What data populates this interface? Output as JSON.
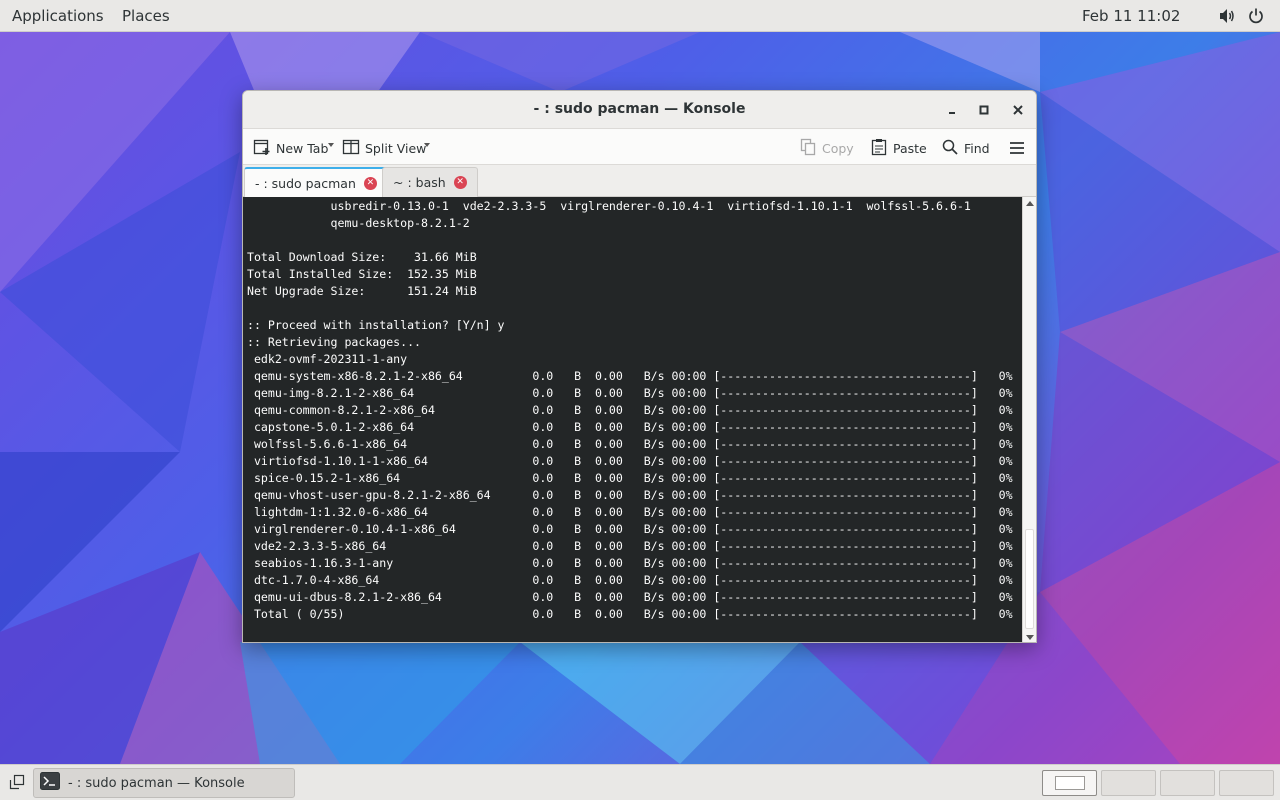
{
  "topbar": {
    "menu_applications": "Applications",
    "menu_places": "Places",
    "clock": "Feb 11  11:02",
    "volume_icon": "volume-icon",
    "power_icon": "power-icon"
  },
  "window": {
    "title": "- : sudo pacman — Konsole",
    "controls": [
      "minimize-icon",
      "maximize-icon",
      "close-icon"
    ]
  },
  "toolbar": {
    "new_tab": "New Tab",
    "split_view": "Split View",
    "copy": "Copy",
    "paste": "Paste",
    "find": "Find",
    "menu_icon": "hamburger-menu-icon"
  },
  "tabs": [
    {
      "label": "- : sudo pacman",
      "active": true
    },
    {
      "label": "~ : bash",
      "active": false
    }
  ],
  "terminal": {
    "lines": [
      "            usbredir-0.13.0-1  vde2-2.3.3-5  virglrenderer-0.10.4-1  virtiofsd-1.10.1-1  wolfssl-5.6.6-1",
      "            qemu-desktop-8.2.1-2",
      "",
      "Total Download Size:    31.66 MiB",
      "Total Installed Size:  152.35 MiB",
      "Net Upgrade Size:      151.24 MiB",
      "",
      ":: Proceed with installation? [Y/n] y",
      ":: Retrieving packages...",
      " edk2-ovmf-202311-1-any",
      " qemu-system-x86-8.2.1-2-x86_64          0.0   B  0.00   B/s 00:00 [------------------------------------]   0%",
      " qemu-img-8.2.1-2-x86_64                 0.0   B  0.00   B/s 00:00 [------------------------------------]   0%",
      " qemu-common-8.2.1-2-x86_64              0.0   B  0.00   B/s 00:00 [------------------------------------]   0%",
      " capstone-5.0.1-2-x86_64                 0.0   B  0.00   B/s 00:00 [------------------------------------]   0%",
      " wolfssl-5.6.6-1-x86_64                  0.0   B  0.00   B/s 00:00 [------------------------------------]   0%",
      " virtiofsd-1.10.1-1-x86_64               0.0   B  0.00   B/s 00:00 [------------------------------------]   0%",
      " spice-0.15.2-1-x86_64                   0.0   B  0.00   B/s 00:00 [------------------------------------]   0%",
      " qemu-vhost-user-gpu-8.2.1-2-x86_64      0.0   B  0.00   B/s 00:00 [------------------------------------]   0%",
      " lightdm-1:1.32.0-6-x86_64               0.0   B  0.00   B/s 00:00 [------------------------------------]   0%",
      " virglrenderer-0.10.4-1-x86_64           0.0   B  0.00   B/s 00:00 [------------------------------------]   0%",
      " vde2-2.3.3-5-x86_64                     0.0   B  0.00   B/s 00:00 [------------------------------------]   0%",
      " seabios-1.16.3-1-any                    0.0   B  0.00   B/s 00:00 [------------------------------------]   0%",
      " dtc-1.7.0-4-x86_64                      0.0   B  0.00   B/s 00:00 [------------------------------------]   0%",
      " qemu-ui-dbus-8.2.1-2-x86_64             0.0   B  0.00   B/s 00:00 [------------------------------------]   0%",
      " Total ( 0/55)                           0.0   B  0.00   B/s 00:00 [------------------------------------]   0%"
    ]
  },
  "taskbar": {
    "show_desktop_icon": "show-desktop-icon",
    "task_label": "- : sudo pacman — Konsole",
    "task_icon": "terminal-icon",
    "workspaces": 4,
    "active_workspace": 1
  },
  "colors": {
    "terminal_bg": "#232627",
    "terminal_fg": "#fcfcfc",
    "tab_close": "#da4453",
    "accent": "#3daee9"
  }
}
